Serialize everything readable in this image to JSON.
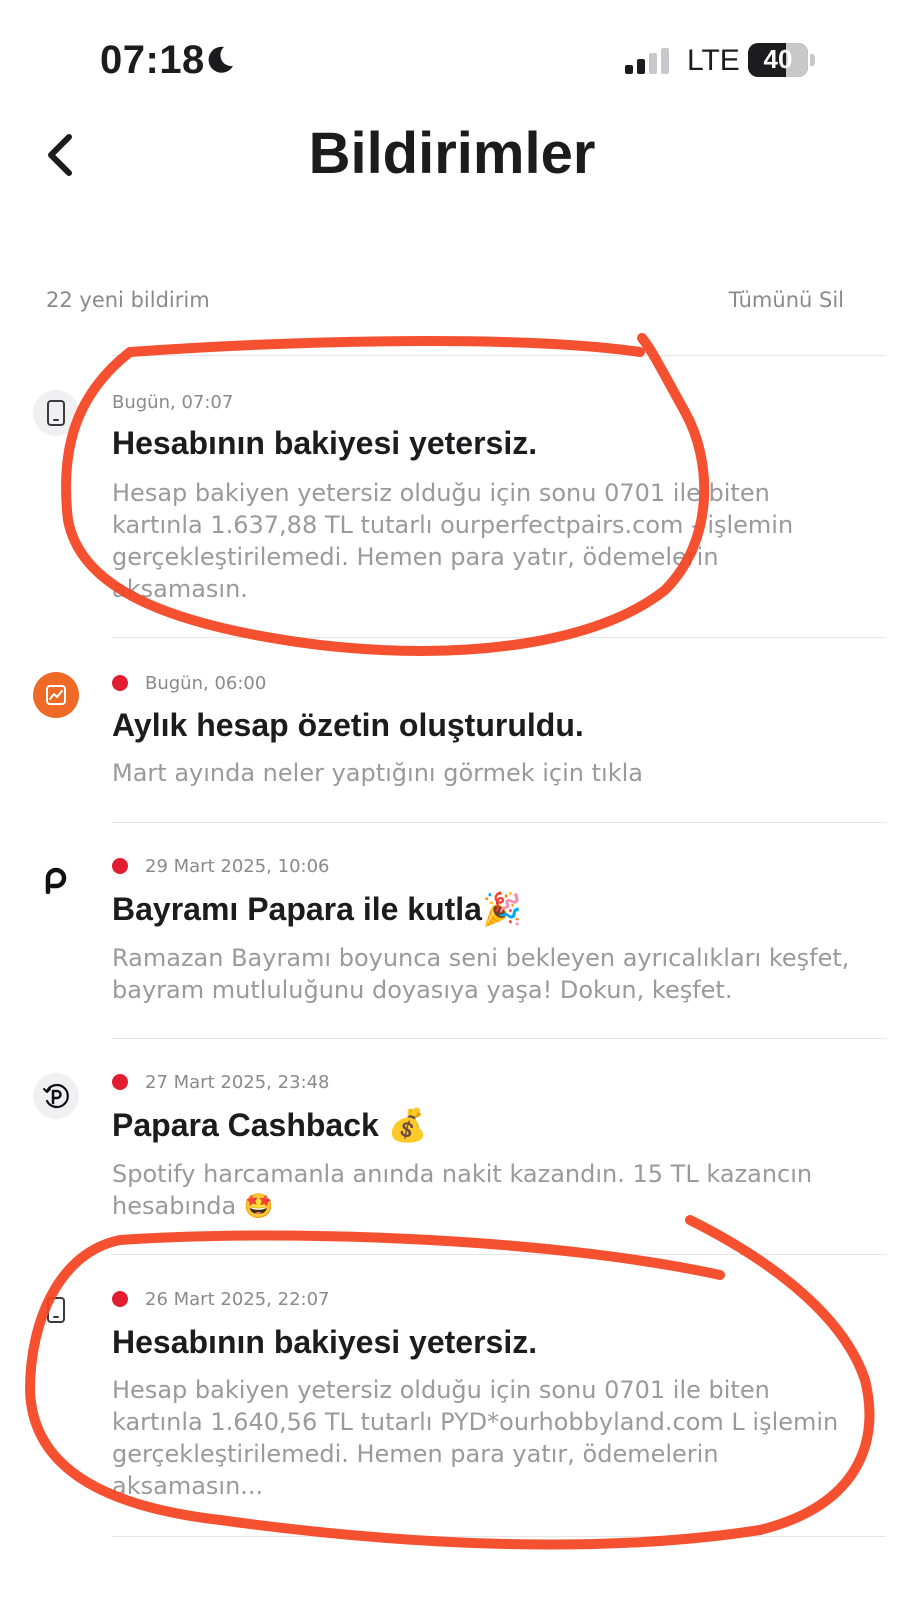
{
  "status_bar": {
    "time": "07:18",
    "moon_icon": "moon-icon",
    "signal_icon": "cellular-signal-icon",
    "network": "LTE",
    "battery": "40",
    "battery_level_percent": 40
  },
  "header": {
    "back_icon": "chevron-left-icon",
    "title": "Bildirimler"
  },
  "summary": {
    "count_label": "22 yeni bildirim",
    "delete_all_label": "Tümünü Sil"
  },
  "notifications": [
    {
      "icon": "phone-icon",
      "unread": false,
      "time": "Bugün, 07:07",
      "title": "Hesabının bakiyesi yetersiz.",
      "body": "Hesap bakiyen yetersiz olduğu için sonu 0701 ile biten kartınla 1.637,88 TL tutarlı ourperfectpairs.com - işlemin gerçekleştirilemedi. Hemen para yatır, ödemelerin aksamasın."
    },
    {
      "icon": "chart-icon",
      "unread": true,
      "time": "Bugün, 06:00",
      "title": "Aylık hesap özetin oluşturuldu.",
      "body": "Mart ayında neler yaptığını görmek için tıkla"
    },
    {
      "icon": "papara-logo-icon",
      "unread": true,
      "time": "29 Mart 2025, 10:06",
      "title": "Bayramı Papara ile kutla🎉",
      "body": "Ramazan Bayramı boyunca seni bekleyen ayrıcalıkları keşfet, bayram mutluluğunu doyasıya yaşa! Dokun, keşfet."
    },
    {
      "icon": "cashback-icon",
      "unread": true,
      "time": "27 Mart 2025, 23:48",
      "title": "Papara Cashback 💰",
      "body": "Spotify harcamanla anında nakit kazandın. 15 TL kazancın hesabında 🤩"
    },
    {
      "icon": "phone-icon",
      "unread": true,
      "time": "26 Mart 2025, 22:07",
      "title": "Hesabının bakiyesi yetersiz.",
      "body": "Hesap bakiyen yetersiz olduğu için sonu 0701 ile biten kartınla 1.640,56 TL tutarlı PYD*ourhobbyland.com L işlemin gerçekleştirilemedi. Hemen para yatır, ödemelerin aksamasın..."
    }
  ],
  "colors": {
    "unread_dot": "#e21d2f",
    "chart_icon_bg": "#f06a27",
    "scribble": "#f4421f",
    "muted_text": "#9a9a9e"
  }
}
